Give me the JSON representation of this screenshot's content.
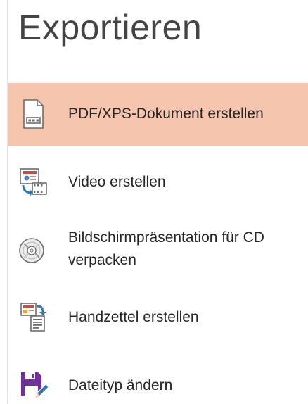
{
  "header": {
    "title": "Exportieren"
  },
  "items": [
    {
      "label": "PDF/XPS-Dokument erstellen",
      "icon": "pdf-document-icon",
      "selected": true
    },
    {
      "label": "Video erstellen",
      "icon": "video-icon",
      "selected": false
    },
    {
      "label_line1": "Bildschirmpräsentation für CD",
      "label_line2": "verpacken",
      "icon": "cd-icon",
      "selected": false
    },
    {
      "label": "Handzettel erstellen",
      "icon": "handout-icon",
      "selected": false
    },
    {
      "label": "Dateityp ändern",
      "icon": "floppy-disk-edit-icon",
      "selected": false
    }
  ],
  "colors": {
    "selected_background": "#f6c5ae",
    "title_text": "#444444",
    "item_text": "#262626"
  }
}
